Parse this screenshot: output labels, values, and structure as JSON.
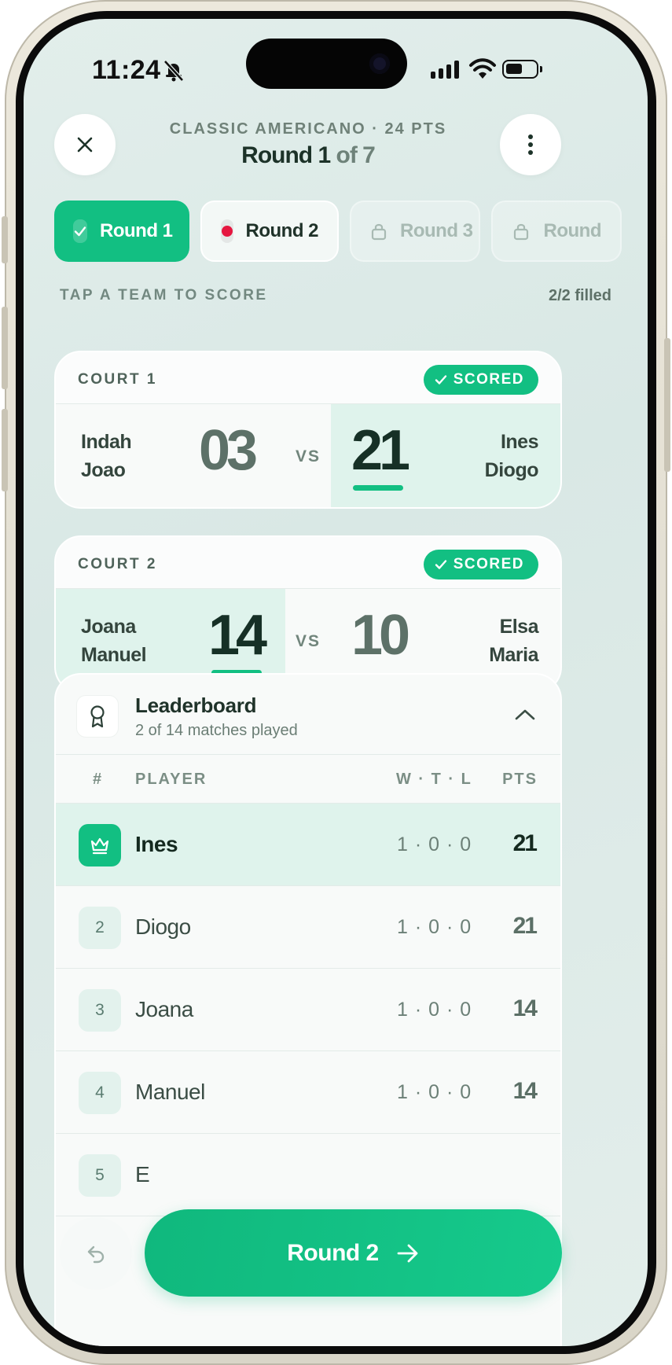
{
  "status_bar": {
    "time": "11:24"
  },
  "header": {
    "subtitle": "CLASSIC AMERICANO · 24 PTS",
    "title_main": "Round 1",
    "title_suffix": " of 7"
  },
  "tabs": [
    {
      "label": "Round 1",
      "state": "completed"
    },
    {
      "label": "Round 2",
      "state": "active"
    },
    {
      "label": "Round 3",
      "state": "locked"
    },
    {
      "label": "Round",
      "state": "locked"
    }
  ],
  "section": {
    "label": "TAP A TEAM TO SCORE",
    "count": "2/2 filled"
  },
  "courts": [
    {
      "label": "COURT 1",
      "badge": "SCORED",
      "team_a": {
        "p1": "Indah",
        "p2": "Joao",
        "score": "03"
      },
      "vs": "VS",
      "team_b": {
        "p1": "Ines",
        "p2": "Diogo",
        "score": "21"
      },
      "winner": "b"
    },
    {
      "label": "COURT 2",
      "badge": "SCORED",
      "team_a": {
        "p1": "Joana",
        "p2": "Manuel",
        "score": "14"
      },
      "vs": "VS",
      "team_b": {
        "p1": "Elsa",
        "p2": "Maria",
        "score": "10"
      },
      "winner": "a"
    }
  ],
  "leaderboard": {
    "title": "Leaderboard",
    "subtitle": "2 of 14 matches played",
    "columns": {
      "rank": "#",
      "player": "PLAYER",
      "wtl": "W · T · L",
      "pts": "PTS"
    },
    "rows": [
      {
        "rank": "1",
        "name": "Ines",
        "wtl": "1 · 0 · 0",
        "pts": "21"
      },
      {
        "rank": "2",
        "name": "Diogo",
        "wtl": "1 · 0 · 0",
        "pts": "21"
      },
      {
        "rank": "3",
        "name": "Joana",
        "wtl": "1 · 0 · 0",
        "pts": "14"
      },
      {
        "rank": "4",
        "name": "Manuel",
        "wtl": "1 · 0 · 0",
        "pts": "14"
      },
      {
        "rank": "5",
        "name": "E"
      }
    ]
  },
  "cta": {
    "label": "Round 2"
  },
  "colors": {
    "accent": "#12bf82",
    "live_dot": "#e5163f",
    "text_dark": "#1c3228"
  },
  "icons": {
    "close": "close-icon",
    "more": "more-vertical-icon",
    "check": "check-icon",
    "lock": "lock-icon",
    "award": "award-icon",
    "chevron": "chevron-up-icon",
    "crown": "crown-icon",
    "undo": "undo-icon",
    "arrow": "arrow-right-icon"
  }
}
